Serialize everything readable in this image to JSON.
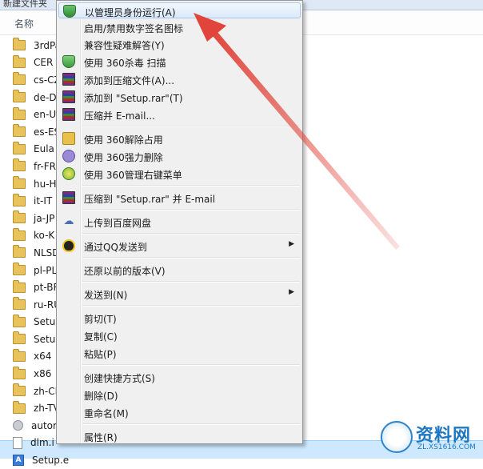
{
  "header": {
    "folder_title": "新建文件夹",
    "column_name": "名称"
  },
  "files": [
    {
      "name": "3rdPa",
      "icon": "folder"
    },
    {
      "name": "CER",
      "icon": "folder"
    },
    {
      "name": "cs-CZ",
      "icon": "folder"
    },
    {
      "name": "de-D",
      "icon": "folder"
    },
    {
      "name": "en-U",
      "icon": "folder"
    },
    {
      "name": "es-ES",
      "icon": "folder"
    },
    {
      "name": "Eula",
      "icon": "folder"
    },
    {
      "name": "fr-FR",
      "icon": "folder"
    },
    {
      "name": "hu-H",
      "icon": "folder"
    },
    {
      "name": "it-IT",
      "icon": "folder"
    },
    {
      "name": "ja-JP",
      "icon": "folder"
    },
    {
      "name": "ko-K",
      "icon": "folder"
    },
    {
      "name": "NLSD",
      "icon": "folder"
    },
    {
      "name": "pl-PL",
      "icon": "folder"
    },
    {
      "name": "pt-BR",
      "icon": "folder"
    },
    {
      "name": "ru-RU",
      "icon": "folder"
    },
    {
      "name": "Setup",
      "icon": "folder"
    },
    {
      "name": "Setup",
      "icon": "folder"
    },
    {
      "name": "x64",
      "icon": "folder"
    },
    {
      "name": "x86",
      "icon": "folder"
    },
    {
      "name": "zh-CI",
      "icon": "folder"
    },
    {
      "name": "zh-TV",
      "icon": "folder"
    },
    {
      "name": "autor",
      "icon": "gear"
    },
    {
      "name": "dlm.i",
      "icon": "file"
    },
    {
      "name": "Setup.exe",
      "icon": "setup"
    }
  ],
  "menu": {
    "items": [
      {
        "label": "以管理员身份运行(A)",
        "icon": "uac-shield-icon"
      },
      {
        "label": "启用/禁用数字签名图标",
        "icon": ""
      },
      {
        "label": "兼容性疑难解答(Y)",
        "icon": ""
      },
      {
        "label": "使用 360杀毒 扫描",
        "icon": "antivirus-360-icon"
      },
      {
        "label": "添加到压缩文件(A)...",
        "icon": "winrar-icon"
      },
      {
        "label": "添加到 \"Setup.rar\"(T)",
        "icon": "winrar-icon"
      },
      {
        "label": "压缩并 E-mail...",
        "icon": "winrar-icon"
      },
      {
        "label": "使用 360解除占用",
        "icon": "unlock-360-icon"
      },
      {
        "label": "使用 360强力删除",
        "icon": "force-delete-360-icon"
      },
      {
        "label": "使用 360管理右键菜单",
        "icon": "menu-manager-360-icon"
      },
      {
        "label": "压缩到 \"Setup.rar\" 并 E-mail",
        "icon": "winrar-icon"
      },
      {
        "label": "上传到百度网盘",
        "icon": "baidu-cloud-icon"
      },
      {
        "label": "通过QQ发送到",
        "icon": "qq-icon"
      },
      {
        "label": "还原以前的版本(V)",
        "icon": ""
      },
      {
        "label": "发送到(N)",
        "icon": ""
      },
      {
        "label": "剪切(T)",
        "icon": ""
      },
      {
        "label": "复制(C)",
        "icon": ""
      },
      {
        "label": "粘贴(P)",
        "icon": ""
      },
      {
        "label": "创建快捷方式(S)",
        "icon": ""
      },
      {
        "label": "删除(D)",
        "icon": ""
      },
      {
        "label": "重命名(M)",
        "icon": ""
      },
      {
        "label": "属性(R)",
        "icon": ""
      }
    ],
    "submenu_arrow": "▶"
  },
  "watermark": {
    "title": "资料网",
    "url": "ZL.XS1616.COM"
  },
  "colors": {
    "menu_bg": "#f0f0f0",
    "highlight": "#dbe9fa",
    "arrow": "#e0443a",
    "folder": "#e8c25a",
    "selection": "#cde8ff"
  }
}
